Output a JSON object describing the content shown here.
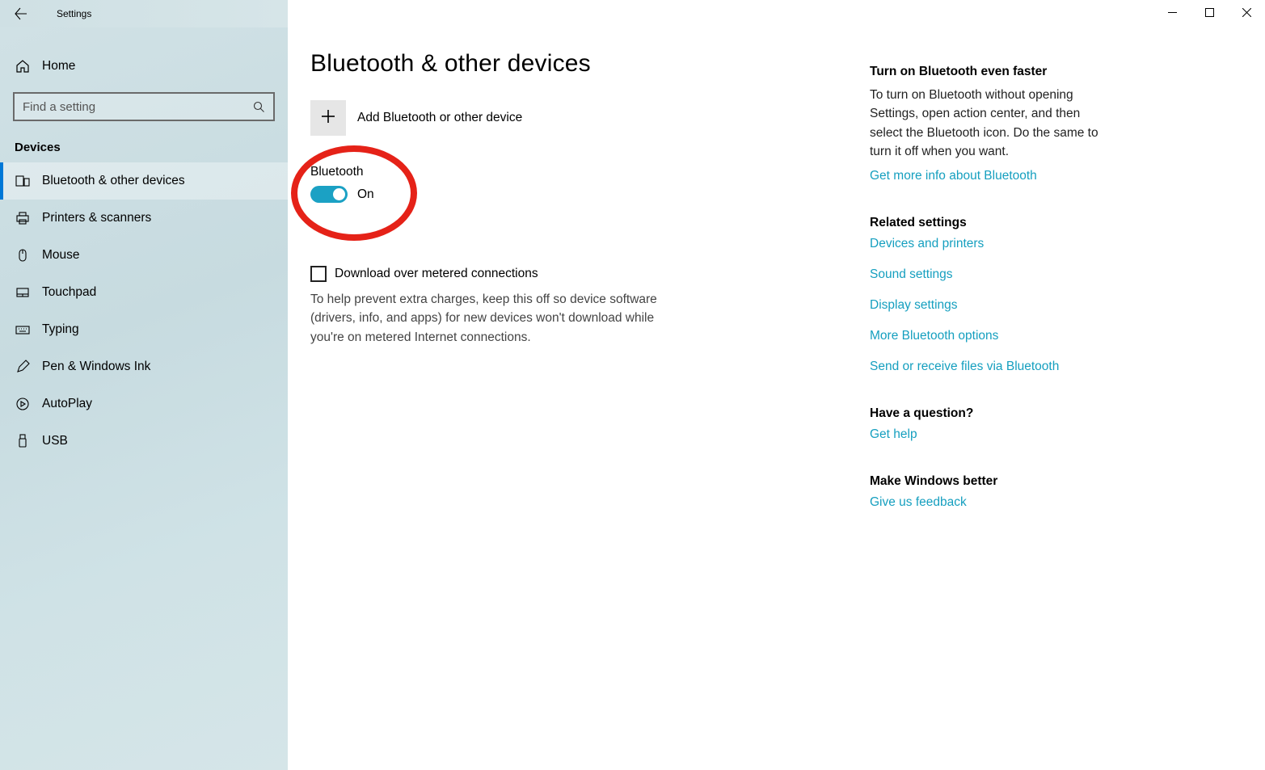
{
  "titlebar": {
    "app_name": "Settings"
  },
  "sidebar": {
    "home": "Home",
    "search_placeholder": "Find a setting",
    "category": "Devices",
    "items": [
      {
        "label": "Bluetooth & other devices"
      },
      {
        "label": "Printers & scanners"
      },
      {
        "label": "Mouse"
      },
      {
        "label": "Touchpad"
      },
      {
        "label": "Typing"
      },
      {
        "label": "Pen & Windows Ink"
      },
      {
        "label": "AutoPlay"
      },
      {
        "label": "USB"
      }
    ]
  },
  "main": {
    "page_title": "Bluetooth & other devices",
    "add_label": "Add Bluetooth or other device",
    "bt_label": "Bluetooth",
    "bt_state": "On",
    "metered_label": "Download over metered connections",
    "metered_desc": "To help prevent extra charges, keep this off so device software (drivers, info, and apps) for new devices won't download while you're on metered Internet connections."
  },
  "right": {
    "faster_heading": "Turn on Bluetooth even faster",
    "faster_text": "To turn on Bluetooth without opening Settings, open action center, and then select the Bluetooth icon. Do the same to turn it off when you want.",
    "faster_link": "Get more info about Bluetooth",
    "related_heading": "Related settings",
    "related_links": [
      "Devices and printers",
      "Sound settings",
      "Display settings",
      "More Bluetooth options",
      "Send or receive files via Bluetooth"
    ],
    "question_heading": "Have a question?",
    "question_link": "Get help",
    "better_heading": "Make Windows better",
    "better_link": "Give us feedback"
  }
}
